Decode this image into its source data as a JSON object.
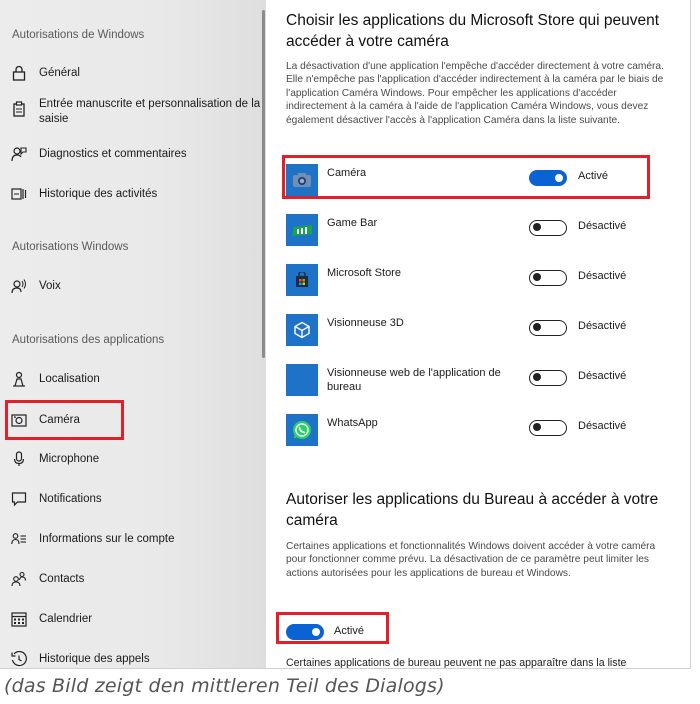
{
  "sidebar": {
    "sections": {
      "windows_permissions": "Autorisations de Windows",
      "windows_permissions_2": "Autorisations Windows",
      "app_permissions": "Autorisations des applications"
    },
    "items": [
      {
        "label": "Général",
        "icon": "lock-icon"
      },
      {
        "label": "Entrée manuscrite et personnalisation de la saisie",
        "icon": "clipboard-icon"
      },
      {
        "label": "Diagnostics et commentaires",
        "icon": "feedback-person-icon"
      },
      {
        "label": "Historique des activités",
        "icon": "activity-history-icon"
      },
      {
        "label": "Voix",
        "icon": "speech-icon"
      },
      {
        "label": "Localisation",
        "icon": "location-person-icon"
      },
      {
        "label": "Caméra",
        "icon": "camera-icon"
      },
      {
        "label": "Microphone",
        "icon": "microphone-icon"
      },
      {
        "label": "Notifications",
        "icon": "notifications-icon"
      },
      {
        "label": "Informations sur le compte",
        "icon": "account-info-icon"
      },
      {
        "label": "Contacts",
        "icon": "contacts-icon"
      },
      {
        "label": "Calendrier",
        "icon": "calendar-icon"
      },
      {
        "label": "Historique des appels",
        "icon": "call-history-icon"
      }
    ]
  },
  "main": {
    "store_heading": "Choisir les applications du Microsoft Store qui peuvent accéder à votre caméra",
    "store_description": "La désactivation d'une application l'empêche d'accéder directement à votre caméra. Elle n'empêche pas l'application d'accéder indirectement à la caméra par le biais de l'application Caméra Windows. Pour empêcher les applications d'accéder indirectement à la caméra à l'aide de l'application Caméra Windows, vous devez également désactiver l'accès à l'application Caméra dans la liste suivante.",
    "apps": [
      {
        "name": "Caméra",
        "state": "Activé",
        "on": true,
        "icon": "camera-app-icon",
        "tile_color": "#1e73c8"
      },
      {
        "name": "Game Bar",
        "state": "Désactivé",
        "on": false,
        "icon": "game-bar-icon",
        "tile_color": "#0b7a3b"
      },
      {
        "name": "Microsoft Store",
        "state": "Désactivé",
        "on": false,
        "icon": "store-bag-icon",
        "tile_color": "#1e73c8"
      },
      {
        "name": "Visionneuse 3D",
        "state": "Désactivé",
        "on": false,
        "icon": "3d-cube-icon",
        "tile_color": "#1e73c8"
      },
      {
        "name": "Visionneuse web de l'application de bureau",
        "state": "Désactivé",
        "on": false,
        "icon": "blank-tile-icon",
        "tile_color": "#1e73c8"
      },
      {
        "name": "WhatsApp",
        "state": "Désactivé",
        "on": false,
        "icon": "whatsapp-icon",
        "tile_color": "#1e73c8"
      }
    ],
    "desktop_heading": "Autoriser les applications du Bureau à accéder à votre caméra",
    "desktop_description": "Certaines applications et fonctionnalités Windows doivent accéder à votre caméra pour fonctionner comme prévu. La désactivation de ce paramètre peut limiter les actions autorisées pour les applications de bureau et Windows.",
    "desktop_toggle_state": "Activé",
    "desktop_footer": "Certaines applications de bureau peuvent ne pas apparaître dans la liste"
  },
  "caption": "(das Bild zeigt den mittleren Teil des Dialogs)",
  "colors": {
    "accent": "#0a63d3",
    "highlight": "#e0202a"
  }
}
